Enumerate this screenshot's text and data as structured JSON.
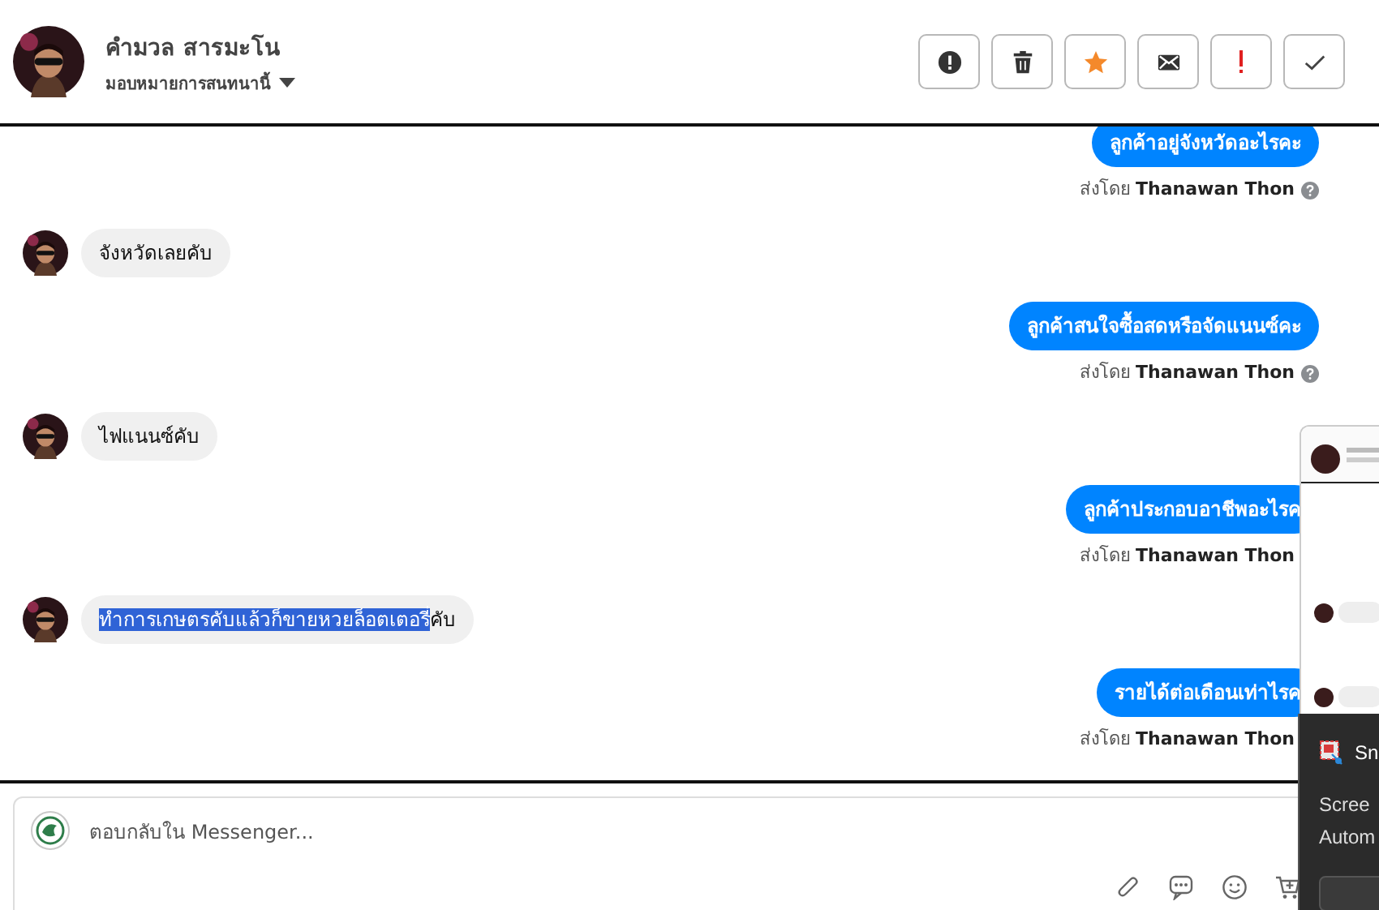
{
  "conversation": {
    "name": "คำมวล สารมะโน",
    "assign_label": "มอบหมายการสนทนานี้"
  },
  "actions": [
    {
      "kind": "report"
    },
    {
      "kind": "delete"
    },
    {
      "kind": "star"
    },
    {
      "kind": "mail"
    },
    {
      "kind": "important"
    },
    {
      "kind": "done"
    }
  ],
  "messages": [
    {
      "kind": "sent",
      "text": "ลูกค้าอยู่จังหวัดอะไรคะ",
      "caption": "ส่งโดย **Thanawan Thon**",
      "help_icon": true
    },
    {
      "kind": "received",
      "text": "จังหวัดเลยคับ"
    },
    {
      "kind": "sent",
      "text": "ลูกค้าสนใจซื้อสดหรือจัดแนนซ์คะ",
      "caption": "ส่งโดย **Thanawan Thon**",
      "help_icon": true
    },
    {
      "kind": "received",
      "text": "ไฟแนนซ์คับ"
    },
    {
      "kind": "sent",
      "text": "ลูกค้าประกอบอาชีพอะไรค",
      "caption": "ส่งโดย **Thanawan Thon**",
      "help_icon": false
    },
    {
      "kind": "received",
      "selected_text": "ทำการเกษตรคับแล้วก็ขายหวยล็อตเตอรี่",
      "text": "คับ"
    },
    {
      "kind": "sent",
      "text": "รายได้ต่อเดือนเท่าไรค",
      "caption": "ส่งโดย **Thanawan Thon**",
      "help_icon": false
    }
  ],
  "composer": {
    "placeholder": "ตอบกลับใน Messenger...",
    "tools": [
      {
        "kind": "attach"
      },
      {
        "kind": "saved-replies"
      },
      {
        "kind": "emoji"
      },
      {
        "kind": "cart"
      }
    ]
  },
  "notification": {
    "app": "Sn",
    "lines": [
      "Scree",
      "Autom"
    ]
  }
}
